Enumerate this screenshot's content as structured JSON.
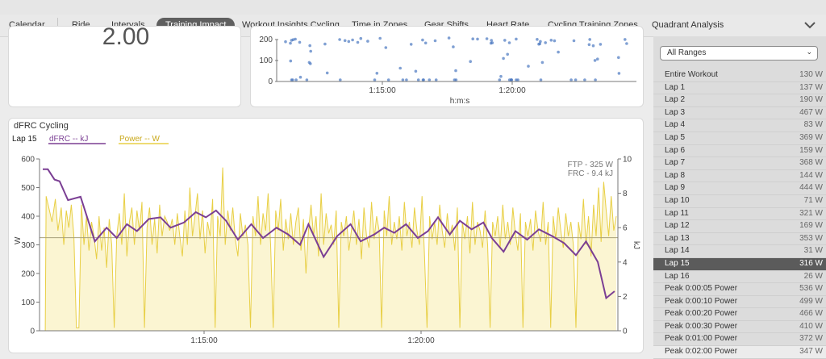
{
  "tabs": [
    {
      "label": "Calendar"
    },
    {
      "label": "Ride"
    },
    {
      "label": "Intervals"
    },
    {
      "label": "Training Impact"
    },
    {
      "label": "Workout Insights Cycling"
    },
    {
      "label": "Time in Zones"
    },
    {
      "label": "Gear Shifts"
    },
    {
      "label": "Heart Rate"
    },
    {
      "label": "Cycling Training Zones"
    },
    {
      "label": "Quadrant Analysis"
    }
  ],
  "active_tab": "Training Impact",
  "metric_card": {
    "value": "2.00"
  },
  "scatter_card": {
    "y_ticks": [
      "200",
      "100",
      "0"
    ],
    "x_ticks": [
      "1:15:00",
      "1:20:00"
    ],
    "xlabel": "h:m:s"
  },
  "dfrc_chart": {
    "title": "dFRC Cycling",
    "lap_label": "Lap 15",
    "legend_dfrc": "dFRC  -- kJ",
    "legend_power": "Power  -- W",
    "ftp_text": "FTP - 325 W",
    "frc_text": "FRC - 9.4 kJ",
    "left_axis_label": "W",
    "right_axis_label": "kJ",
    "colors": {
      "dfrc": "#7b3f94",
      "power": "#e8cf45",
      "power_fill": "#fbf5d2",
      "ftp_line": "#a8a07a"
    }
  },
  "range_select": {
    "value": "All Ranges"
  },
  "ranges": [
    {
      "name": "Entire Workout",
      "value": "130 W"
    },
    {
      "name": "Lap 1",
      "value": "137 W"
    },
    {
      "name": "Lap 2",
      "value": "190 W"
    },
    {
      "name": "Lap 3",
      "value": "467 W"
    },
    {
      "name": "Lap 4",
      "value": "83 W"
    },
    {
      "name": "Lap 5",
      "value": "369 W"
    },
    {
      "name": "Lap 6",
      "value": "159 W"
    },
    {
      "name": "Lap 7",
      "value": "368 W"
    },
    {
      "name": "Lap 8",
      "value": "144 W"
    },
    {
      "name": "Lap 9",
      "value": "444 W"
    },
    {
      "name": "Lap 10",
      "value": "71 W"
    },
    {
      "name": "Lap 11",
      "value": "321 W"
    },
    {
      "name": "Lap 12",
      "value": "169 W"
    },
    {
      "name": "Lap 13",
      "value": "353 W"
    },
    {
      "name": "Lap 14",
      "value": "31 W"
    },
    {
      "name": "Lap 15",
      "value": "316 W",
      "selected": true
    },
    {
      "name": "Lap 16",
      "value": "26 W"
    },
    {
      "name": "Peak 0:00:05 Power",
      "value": "536 W"
    },
    {
      "name": "Peak 0:00:10 Power",
      "value": "499 W"
    },
    {
      "name": "Peak 0:00:20 Power",
      "value": "466 W"
    },
    {
      "name": "Peak 0:00:30 Power",
      "value": "410 W"
    },
    {
      "name": "Peak 0:01:00 Power",
      "value": "372 W"
    },
    {
      "name": "Peak 0:02:00 Power",
      "value": "347 W"
    }
  ],
  "chart_data": {
    "type": "line",
    "x_axis_unit": "h:m:s",
    "x_range": [
      "1:11:55",
      "1:23:30"
    ],
    "x_ticks": [
      "1:15:00",
      "1:20:00"
    ],
    "y_left": {
      "label": "W",
      "range": [
        0,
        600
      ],
      "ticks": [
        0,
        100,
        200,
        300,
        400,
        500,
        600
      ]
    },
    "y_right": {
      "label": "kJ",
      "range": [
        0,
        10
      ],
      "ticks": [
        0,
        2,
        4,
        6,
        8,
        10
      ]
    },
    "reference_lines": [
      {
        "name": "FTP",
        "value": 325,
        "axis": "left"
      }
    ],
    "series": [
      {
        "name": "dFRC",
        "axis": "right",
        "points": [
          [
            0,
            9.4
          ],
          [
            6,
            9.4
          ],
          [
            14,
            8.8
          ],
          [
            20,
            8.7
          ],
          [
            30,
            7.6
          ],
          [
            45,
            7.8
          ],
          [
            62,
            5.2
          ],
          [
            76,
            6.0
          ],
          [
            88,
            5.4
          ],
          [
            100,
            6.2
          ],
          [
            112,
            5.8
          ],
          [
            126,
            6.5
          ],
          [
            140,
            6.6
          ],
          [
            152,
            6.0
          ],
          [
            168,
            6.3
          ],
          [
            182,
            6.9
          ],
          [
            194,
            6.6
          ],
          [
            206,
            7.0
          ],
          [
            218,
            6.4
          ],
          [
            232,
            5.3
          ],
          [
            248,
            6.2
          ],
          [
            262,
            5.4
          ],
          [
            278,
            6.0
          ],
          [
            292,
            5.6
          ],
          [
            306,
            5.0
          ],
          [
            316,
            6.2
          ],
          [
            334,
            4.3
          ],
          [
            350,
            5.5
          ],
          [
            366,
            6.2
          ],
          [
            378,
            5.2
          ],
          [
            394,
            5.6
          ],
          [
            406,
            6.0
          ],
          [
            418,
            5.7
          ],
          [
            432,
            6.2
          ],
          [
            446,
            5.4
          ],
          [
            458,
            5.8
          ],
          [
            470,
            6.6
          ],
          [
            484,
            5.6
          ],
          [
            496,
            6.4
          ],
          [
            510,
            5.9
          ],
          [
            524,
            6.3
          ],
          [
            534,
            5.4
          ],
          [
            548,
            4.6
          ],
          [
            562,
            5.8
          ],
          [
            576,
            5.3
          ],
          [
            590,
            5.9
          ],
          [
            606,
            5.5
          ],
          [
            620,
            5.1
          ],
          [
            634,
            4.4
          ],
          [
            646,
            5.2
          ],
          [
            660,
            4.0
          ],
          [
            670,
            1.9
          ],
          [
            680,
            2.3
          ]
        ]
      },
      {
        "name": "Power",
        "axis": "left",
        "points": [
          [
            0,
            0
          ],
          [
            3,
            0
          ],
          [
            4,
            470
          ],
          [
            8,
            420
          ],
          [
            11,
            380
          ],
          [
            15,
            460
          ],
          [
            18,
            350
          ],
          [
            22,
            430
          ],
          [
            25,
            300
          ],
          [
            28,
            420
          ],
          [
            31,
            360
          ],
          [
            34,
            440
          ],
          [
            37,
            330
          ],
          [
            40,
            10
          ],
          [
            43,
            10
          ],
          [
            46,
            440
          ],
          [
            49,
            300
          ],
          [
            52,
            400
          ],
          [
            55,
            280
          ],
          [
            58,
            380
          ],
          [
            61,
            330
          ],
          [
            64,
            250
          ],
          [
            67,
            400
          ],
          [
            70,
            280
          ],
          [
            73,
            360
          ],
          [
            76,
            220
          ],
          [
            79,
            390
          ],
          [
            82,
            300
          ],
          [
            85,
            10
          ],
          [
            88,
            330
          ],
          [
            91,
            410
          ],
          [
            94,
            300
          ],
          [
            97,
            480
          ],
          [
            100,
            260
          ],
          [
            103,
            380
          ],
          [
            106,
            430
          ],
          [
            109,
            300
          ],
          [
            112,
            420
          ],
          [
            115,
            350
          ],
          [
            118,
            450
          ],
          [
            121,
            10
          ],
          [
            124,
            360
          ],
          [
            127,
            430
          ],
          [
            130,
            300
          ],
          [
            133,
            390
          ],
          [
            136,
            270
          ],
          [
            139,
            440
          ],
          [
            142,
            330
          ],
          [
            145,
            400
          ],
          [
            148,
            380
          ],
          [
            151,
            350
          ],
          [
            154,
            390
          ],
          [
            157,
            300
          ],
          [
            160,
            410
          ],
          [
            163,
            330
          ],
          [
            166,
            260
          ],
          [
            169,
            420
          ],
          [
            172,
            300
          ],
          [
            175,
            500
          ],
          [
            178,
            330
          ],
          [
            181,
            400
          ],
          [
            184,
            480
          ],
          [
            187,
            320
          ],
          [
            190,
            420
          ],
          [
            193,
            270
          ],
          [
            196,
            380
          ],
          [
            199,
            330
          ],
          [
            202,
            460
          ],
          [
            205,
            10
          ],
          [
            208,
            400
          ],
          [
            211,
            330
          ],
          [
            214,
            570
          ],
          [
            217,
            300
          ],
          [
            220,
            420
          ],
          [
            223,
            350
          ],
          [
            226,
            430
          ],
          [
            229,
            320
          ],
          [
            232,
            260
          ],
          [
            235,
            410
          ],
          [
            238,
            330
          ],
          [
            241,
            370
          ],
          [
            244,
            300
          ],
          [
            247,
            10
          ],
          [
            250,
            400
          ],
          [
            253,
            330
          ],
          [
            256,
            470
          ],
          [
            259,
            300
          ],
          [
            262,
            410
          ],
          [
            265,
            350
          ],
          [
            268,
            480
          ],
          [
            271,
            300
          ],
          [
            274,
            10
          ],
          [
            277,
            420
          ],
          [
            280,
            350
          ],
          [
            283,
            460
          ],
          [
            286,
            280
          ],
          [
            289,
            390
          ],
          [
            292,
            320
          ],
          [
            295,
            410
          ],
          [
            298,
            300
          ],
          [
            301,
            380
          ],
          [
            304,
            430
          ],
          [
            307,
            280
          ],
          [
            310,
            390
          ],
          [
            313,
            200
          ],
          [
            316,
            350
          ],
          [
            319,
            440
          ],
          [
            322,
            330
          ],
          [
            325,
            400
          ],
          [
            328,
            260
          ],
          [
            331,
            480
          ],
          [
            334,
            300
          ],
          [
            337,
            410
          ],
          [
            340,
            340
          ],
          [
            343,
            370
          ],
          [
            346,
            300
          ],
          [
            349,
            420
          ],
          [
            352,
            10
          ],
          [
            355,
            380
          ],
          [
            358,
            330
          ],
          [
            361,
            400
          ],
          [
            364,
            280
          ],
          [
            367,
            350
          ],
          [
            370,
            420
          ],
          [
            373,
            300
          ],
          [
            376,
            390
          ],
          [
            379,
            250
          ],
          [
            382,
            430
          ],
          [
            385,
            330
          ],
          [
            388,
            290
          ],
          [
            391,
            450
          ],
          [
            394,
            320
          ],
          [
            397,
            400
          ],
          [
            400,
            350
          ],
          [
            403,
            10
          ],
          [
            406,
            420
          ],
          [
            409,
            330
          ],
          [
            412,
            470
          ],
          [
            415,
            300
          ],
          [
            418,
            380
          ],
          [
            421,
            320
          ],
          [
            424,
            400
          ],
          [
            427,
            280
          ],
          [
            430,
            450
          ],
          [
            433,
            330
          ],
          [
            436,
            380
          ],
          [
            439,
            290
          ],
          [
            442,
            430
          ],
          [
            445,
            350
          ],
          [
            448,
            300
          ],
          [
            451,
            470
          ],
          [
            454,
            260
          ],
          [
            457,
            10
          ],
          [
            460,
            400
          ],
          [
            463,
            320
          ],
          [
            466,
            380
          ],
          [
            469,
            300
          ],
          [
            472,
            440
          ],
          [
            475,
            350
          ],
          [
            478,
            290
          ],
          [
            481,
            410
          ],
          [
            484,
            330
          ],
          [
            487,
            370
          ],
          [
            490,
            280
          ],
          [
            493,
            430
          ],
          [
            496,
            10
          ],
          [
            499,
            380
          ],
          [
            502,
            320
          ],
          [
            505,
            400
          ],
          [
            508,
            270
          ],
          [
            511,
            450
          ],
          [
            514,
            300
          ],
          [
            517,
            380
          ],
          [
            520,
            350
          ],
          [
            523,
            290
          ],
          [
            526,
            420
          ],
          [
            529,
            300
          ],
          [
            532,
            10
          ],
          [
            535,
            380
          ],
          [
            538,
            330
          ],
          [
            541,
            400
          ],
          [
            544,
            290
          ],
          [
            547,
            440
          ],
          [
            550,
            320
          ],
          [
            553,
            380
          ],
          [
            556,
            300
          ],
          [
            559,
            430
          ],
          [
            562,
            340
          ],
          [
            565,
            280
          ],
          [
            568,
            410
          ],
          [
            571,
            10
          ],
          [
            574,
            380
          ],
          [
            577,
            330
          ],
          [
            580,
            390
          ],
          [
            583,
            280
          ],
          [
            586,
            420
          ],
          [
            589,
            350
          ],
          [
            592,
            310
          ],
          [
            595,
            450
          ],
          [
            598,
            300
          ],
          [
            601,
            380
          ],
          [
            604,
            10
          ],
          [
            607,
            400
          ],
          [
            610,
            320
          ],
          [
            613,
            430
          ],
          [
            616,
            350
          ],
          [
            619,
            290
          ],
          [
            622,
            410
          ],
          [
            625,
            330
          ],
          [
            628,
            380
          ],
          [
            631,
            300
          ],
          [
            634,
            10
          ],
          [
            637,
            380
          ],
          [
            640,
            320
          ],
          [
            643,
            460
          ],
          [
            646,
            300
          ],
          [
            649,
            400
          ],
          [
            652,
            260
          ],
          [
            655,
            440
          ],
          [
            658,
            330
          ],
          [
            661,
            500
          ],
          [
            664,
            310
          ],
          [
            667,
            520
          ],
          [
            670,
            420
          ],
          [
            673,
            330
          ],
          [
            676,
            470
          ],
          [
            679,
            350
          ],
          [
            682,
            400
          ]
        ]
      }
    ]
  }
}
